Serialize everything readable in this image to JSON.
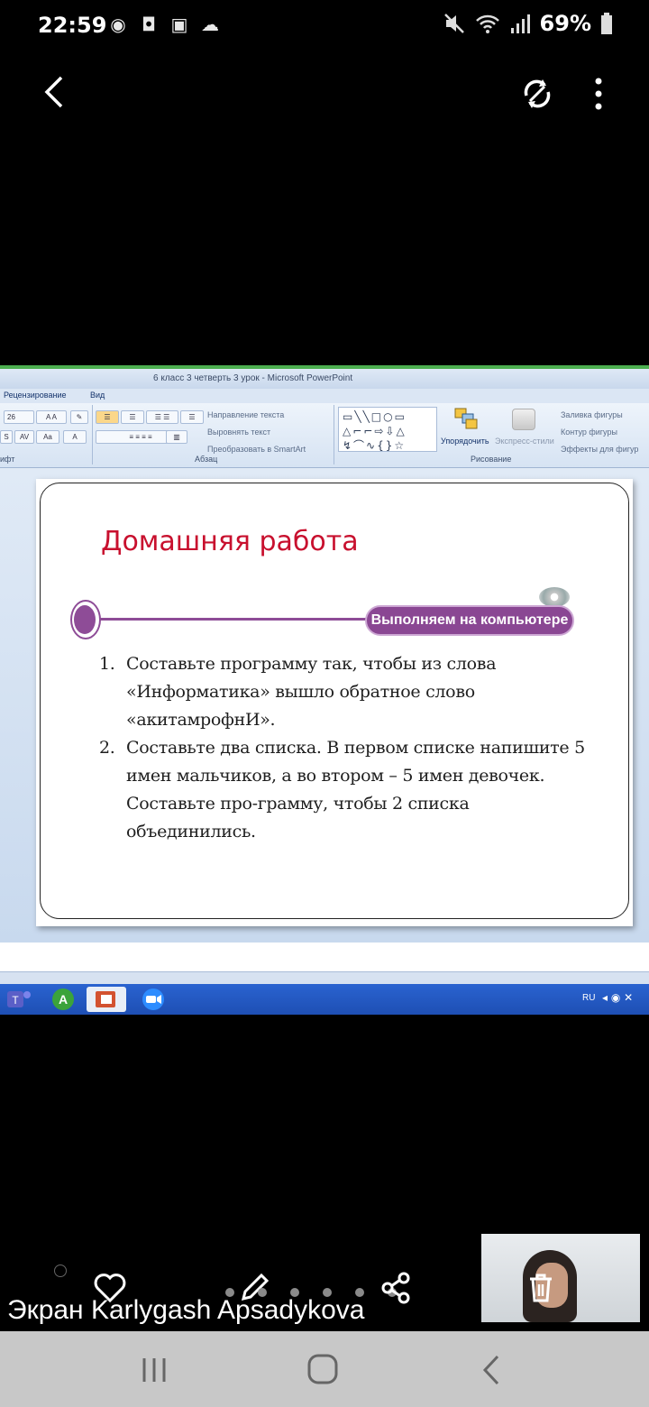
{
  "status_bar": {
    "time": "22:59",
    "battery": "69%",
    "icons": [
      "pinterest-icon",
      "instagram-icon",
      "gallery-icon",
      "cloud-icon",
      "mute-icon",
      "wifi-icon",
      "signal-icon",
      "battery-icon"
    ]
  },
  "viewer": {
    "back": "back-icon",
    "rotate": "rotate-icon",
    "more": "more-vert-icon"
  },
  "window": {
    "title": "6 класс 3 четверть 3 урок - Microsoft PowerPoint",
    "tabs": [
      "Рецензирование",
      "Вид"
    ],
    "font_size": "26",
    "groups": {
      "font": "ифт",
      "paragraph": "Абзац",
      "drawing": "Рисование"
    },
    "paragraph_commands": [
      "Направление текста",
      "Выровнять текст",
      "Преобразовать в SmartArt"
    ],
    "drawing_commands": {
      "arrange": "Упорядочить",
      "express": "Экспресс-стили",
      "fill": "Заливка фигуры",
      "outline": "Контур фигуры",
      "effects": "Эффекты для фигур"
    }
  },
  "slide": {
    "title": "Домашняя работа",
    "badge": "Выполняем на компьютере",
    "tasks": [
      {
        "num": "1.",
        "text": "Составьте программу так, чтобы из слова «Информатика» вышло обратное слово «акитамрофнИ»."
      },
      {
        "num": "2.",
        "text": "Составьте два списка. В первом списке напишите 5 имен мальчиков, а во втором – 5 имен девочек. Составьте про-грамму, чтобы 2 списка объединились."
      }
    ]
  },
  "taskbar": {
    "lang": "RU",
    "apps": [
      "teams-icon",
      "astra-icon",
      "powerpoint-icon",
      "zoom-icon"
    ]
  },
  "controls": {
    "screen_label": "Экран Karlygash Apsadykova",
    "page_dots": 6
  },
  "colors": {
    "title_red": "#c8102e",
    "accent_purple": "#8a4793",
    "status_green": "#4caf50"
  }
}
